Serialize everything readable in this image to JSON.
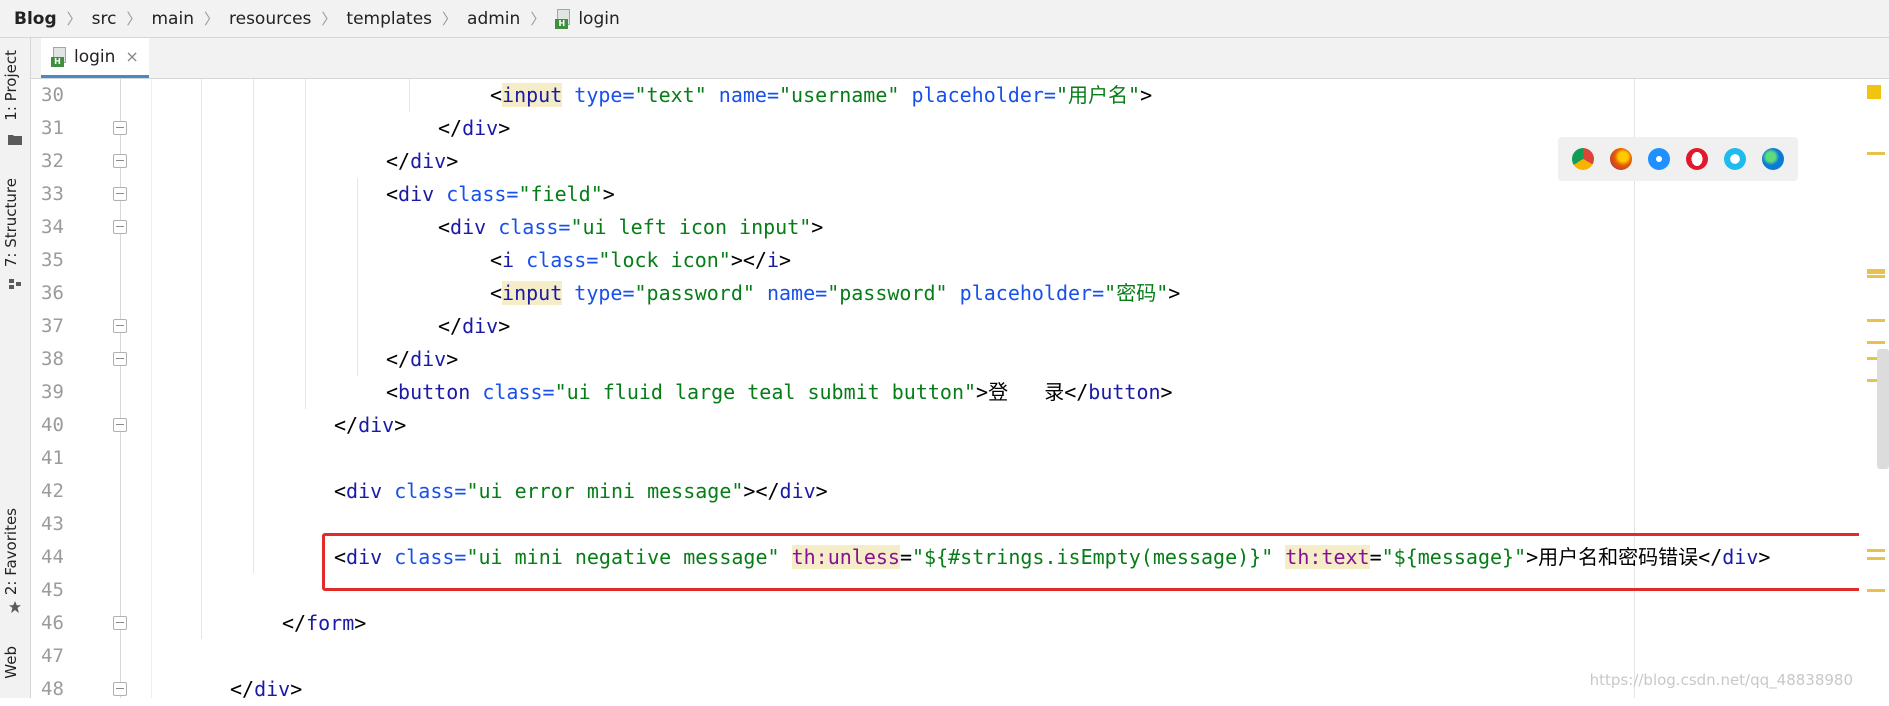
{
  "breadcrumb": [
    "Blog",
    "src",
    "main",
    "resources",
    "templates",
    "admin",
    "login"
  ],
  "left_strip": {
    "project_label": "1: Project",
    "structure_label": "7: Structure",
    "favorites_label": "2: Favorites",
    "web_label": "Web"
  },
  "tab": {
    "label": "login",
    "close": "×"
  },
  "line_numbers": [
    "30",
    "31",
    "32",
    "33",
    "34",
    "35",
    "36",
    "37",
    "38",
    "39",
    "40",
    "41",
    "42",
    "43",
    "44",
    "45",
    "46",
    "47",
    "48"
  ],
  "code": {
    "l30": {
      "a": "<",
      "b": "input",
      "c": " type=",
      "d": "\"text\"",
      "e": " name=",
      "f": "\"username\"",
      "g": " placeholder=",
      "h": "\"用户名\"",
      "i": ">"
    },
    "l31": {
      "a": "</",
      "b": "div",
      "c": ">"
    },
    "l32": {
      "a": "</",
      "b": "div",
      "c": ">"
    },
    "l33": {
      "a": "<",
      "b": "div",
      "c": " class=",
      "d": "\"field\"",
      "e": ">"
    },
    "l34": {
      "a": "<",
      "b": "div",
      "c": " class=",
      "d": "\"ui left icon input\"",
      "e": ">"
    },
    "l35": {
      "a": "<",
      "b": "i",
      "c": " class=",
      "d": "\"lock icon\"",
      "e": "></",
      "f": "i",
      "g": ">"
    },
    "l36": {
      "a": "<",
      "b": "input",
      "c": " type=",
      "d": "\"password\"",
      "e": " name=",
      "f": "\"password\"",
      "g": " placeholder=",
      "h": "\"密码\"",
      "i": ">"
    },
    "l37": {
      "a": "</",
      "b": "div",
      "c": ">"
    },
    "l38": {
      "a": "</",
      "b": "div",
      "c": ">"
    },
    "l39": {
      "a": "<",
      "b": "button",
      "c": " class=",
      "d": "\"ui fluid large teal submit button\"",
      "e": ">登   录</",
      "f": "button",
      "g": ">"
    },
    "l40": {
      "a": "</",
      "b": "div",
      "c": ">"
    },
    "l42": {
      "a": "<",
      "b": "div",
      "c": " class=",
      "d": "\"ui error mini message\"",
      "e": "></",
      "f": "div",
      "g": ">"
    },
    "l44": {
      "a": "<",
      "b": "div",
      "c": " class=",
      "d": "\"ui mini negative message\"",
      "e": " ",
      "f": "th:unless",
      "g": "=",
      "h": "\"${#strings.isEmpty(message)}\"",
      "i": " ",
      "j": "th:text",
      "k": "=",
      "l": "\"${message}\"",
      "m": ">用户名和密码错误</",
      "n": "div",
      "o": ">"
    },
    "l46": {
      "a": "</",
      "b": "form",
      "c": ">"
    },
    "l48": {
      "a": "</",
      "b": "div",
      "c": ">"
    }
  },
  "browser_icons": [
    "chrome-icon",
    "firefox-icon",
    "safari-icon",
    "opera-icon",
    "ie-icon",
    "edge-icon"
  ],
  "colors": {
    "chrome": "#db4437",
    "firefox": "#e66000",
    "safari": "#1e90ff",
    "opera": "#e0192c",
    "ie": "#1ebbee",
    "edge": "#0c7bd6"
  },
  "watermark": "https://blog.csdn.net/qq_48838980"
}
